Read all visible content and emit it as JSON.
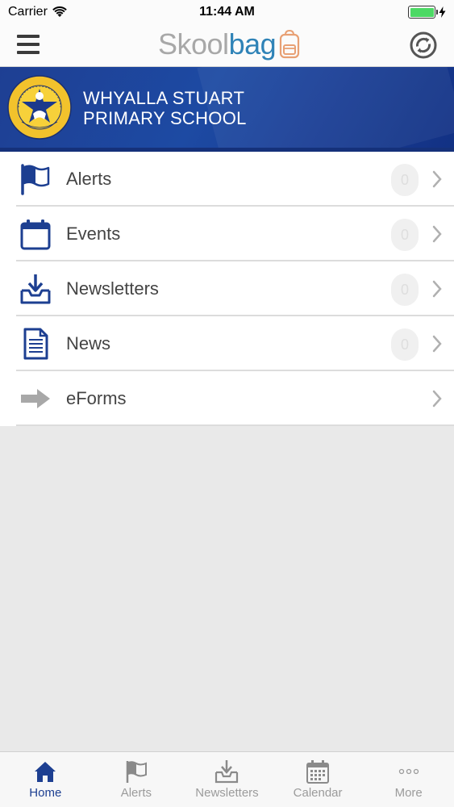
{
  "status_bar": {
    "carrier": "Carrier",
    "time": "11:44 AM"
  },
  "header": {
    "brand_part1": "Skool",
    "brand_part2": "bag",
    "brand_colors": {
      "skool": "#a8a8a8",
      "bag": "#2f83b7",
      "bag_icon": "#e8a074"
    }
  },
  "banner": {
    "school_name_line1": "WHYALLA STUART",
    "school_name_line2": "PRIMARY SCHOOL",
    "background_color": "#1d4aa3"
  },
  "menu": [
    {
      "label": "Alerts",
      "icon": "flag-icon",
      "badge": "0"
    },
    {
      "label": "Events",
      "icon": "calendar-icon",
      "badge": "0"
    },
    {
      "label": "Newsletters",
      "icon": "inbox-download-icon",
      "badge": "0"
    },
    {
      "label": "News",
      "icon": "document-icon",
      "badge": "0"
    },
    {
      "label": "eForms",
      "icon": "arrow-right-icon",
      "badge": null
    }
  ],
  "tabs": [
    {
      "label": "Home",
      "icon": "home-icon",
      "active": true
    },
    {
      "label": "Alerts",
      "icon": "flag-icon",
      "active": false
    },
    {
      "label": "Newsletters",
      "icon": "inbox-download-icon",
      "active": false
    },
    {
      "label": "Calendar",
      "icon": "calendar-icon",
      "active": false
    },
    {
      "label": "More",
      "icon": "ellipsis-icon",
      "active": false
    }
  ],
  "colors": {
    "accent": "#1d3f91",
    "tab_inactive": "#9b9b9b",
    "battery": "#4cd964"
  }
}
